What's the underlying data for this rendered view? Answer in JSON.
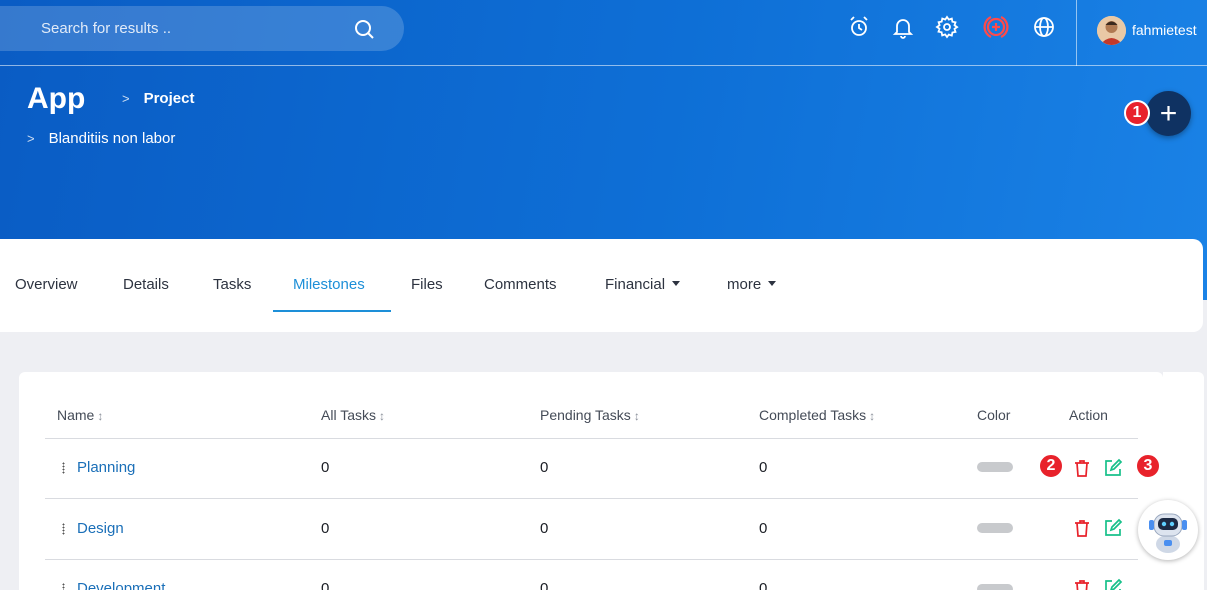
{
  "search": {
    "placeholder": "Search for results .."
  },
  "topbar": {
    "icons": [
      "alarm-clock-icon",
      "bell-icon",
      "gear-icon",
      "add-circle-icon",
      "globe-icon"
    ],
    "username": "fahmietest"
  },
  "header": {
    "app_title": "App",
    "breadcrumb": [
      "Project",
      "Blanditiis non labor"
    ]
  },
  "fab": {
    "label": "+",
    "badge": "1"
  },
  "tabs": [
    {
      "label": "Overview"
    },
    {
      "label": "Details"
    },
    {
      "label": "Tasks"
    },
    {
      "label": "Milestones",
      "active": true
    },
    {
      "label": "Files"
    },
    {
      "label": "Comments"
    },
    {
      "label": "Financial"
    },
    {
      "label": "more"
    }
  ],
  "table": {
    "headers": [
      "Name",
      "All Tasks",
      "Pending Tasks",
      "Completed Tasks",
      "Color",
      "Action"
    ],
    "rows": [
      {
        "name": "Planning",
        "all": "0",
        "pending": "0",
        "completed": "0",
        "color": "#c8cacd"
      },
      {
        "name": "Design",
        "all": "0",
        "pending": "0",
        "completed": "0",
        "color": "#c8cacd"
      },
      {
        "name": "Development",
        "all": "0",
        "pending": "0",
        "completed": "0",
        "color": "#c8cacd"
      }
    ]
  },
  "badges": {
    "delete": "2",
    "edit": "3"
  },
  "colors": {
    "accent": "#1d8fd8",
    "delete": "#e8222b",
    "edit": "#17c08a",
    "fab": "#0f3262"
  }
}
